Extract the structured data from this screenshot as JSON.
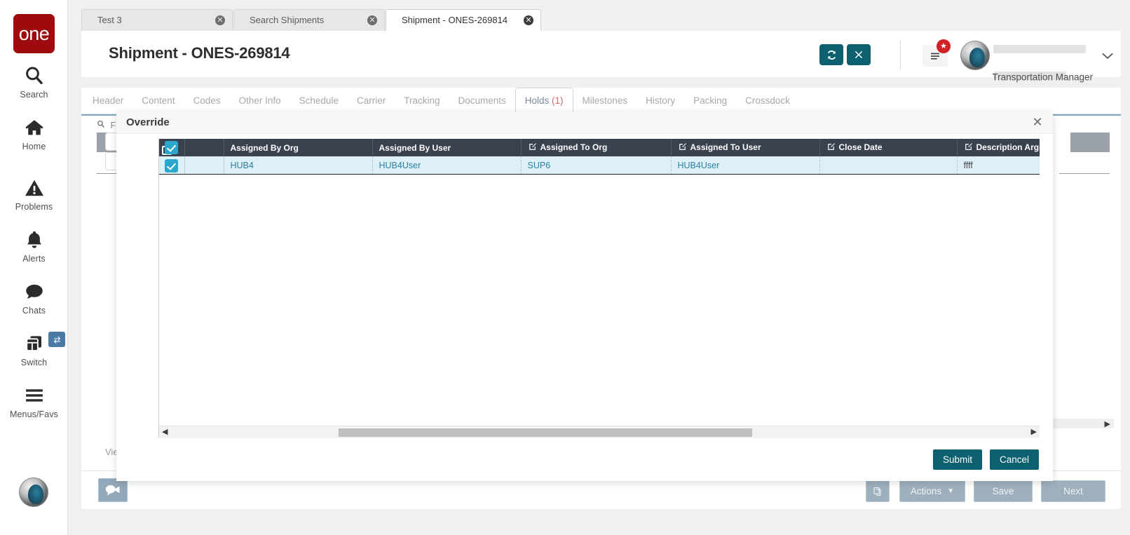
{
  "brand": {
    "logo_text": "one"
  },
  "rail": {
    "items": [
      {
        "label": "Search",
        "icon": "search-icon"
      },
      {
        "label": "Home",
        "icon": "home-icon"
      },
      {
        "label": "Problems",
        "icon": "warning-triangle-icon"
      },
      {
        "label": "Alerts",
        "icon": "bell-icon"
      },
      {
        "label": "Chats",
        "icon": "chat-bubble-icon"
      },
      {
        "label": "Switch",
        "icon": "switch-windows-icon"
      },
      {
        "label": "Menus/Favs",
        "icon": "hamburger-icon"
      }
    ],
    "switch_badge_icon": "swap-arrows-icon",
    "avatar_icon": "user-avatar"
  },
  "browser_tabs": [
    {
      "label": "Test 3",
      "active": false,
      "close_icon": "close-circle-icon"
    },
    {
      "label": "Search Shipments",
      "active": false,
      "close_icon": "close-circle-icon"
    },
    {
      "label": "Shipment - ONES-269814",
      "active": true,
      "close_icon": "close-circle-icon"
    }
  ],
  "header": {
    "title": "Shipment - ONES-269814",
    "refresh_icon": "refresh-icon",
    "close_icon": "x-icon",
    "menu_icon": "list-menu-icon",
    "menu_badge_icon": "star-icon",
    "avatar_icon": "user-avatar",
    "user_role": "Transportation Manager",
    "user_caret_icon": "chevron-down-icon"
  },
  "inner_tabs": [
    {
      "label": "Header",
      "active": false,
      "count": ""
    },
    {
      "label": "Content",
      "active": false,
      "count": ""
    },
    {
      "label": "Codes",
      "active": false,
      "count": ""
    },
    {
      "label": "Other Info",
      "active": false,
      "count": ""
    },
    {
      "label": "Schedule",
      "active": false,
      "count": ""
    },
    {
      "label": "Carrier",
      "active": false,
      "count": ""
    },
    {
      "label": "Tracking",
      "active": false,
      "count": ""
    },
    {
      "label": "Documents",
      "active": false,
      "count": ""
    },
    {
      "label": "Holds",
      "active": true,
      "count": "(1)"
    },
    {
      "label": "Milestones",
      "active": false,
      "count": ""
    },
    {
      "label": "History",
      "active": false,
      "count": ""
    },
    {
      "label": "Packing",
      "active": false,
      "count": ""
    },
    {
      "label": "Crossdock",
      "active": false,
      "count": ""
    }
  ],
  "background": {
    "filter_label": "Fil",
    "filter_icon": "search-icon",
    "view_label": "Vie",
    "chat_icon": "chat-bubbles-icon",
    "buttons": {
      "copy_icon": "copy-icon",
      "actions_label": "Actions",
      "actions_caret_icon": "caret-down-icon",
      "save_label": "Save",
      "next_label": "Next"
    }
  },
  "modal": {
    "title": "Override",
    "close_icon": "x-icon",
    "select_all_checked": true,
    "columns": [
      {
        "label": "",
        "editable": false,
        "type": "select"
      },
      {
        "label": "",
        "editable": false,
        "type": "gap"
      },
      {
        "label": "Assigned By Org",
        "editable": false,
        "type": "text"
      },
      {
        "label": "Assigned By User",
        "editable": false,
        "type": "text"
      },
      {
        "label": "Assigned To Org",
        "editable": true,
        "type": "text"
      },
      {
        "label": "Assigned To User",
        "editable": true,
        "type": "text"
      },
      {
        "label": "Close Date",
        "editable": true,
        "type": "text"
      },
      {
        "label": "Description Args",
        "editable": true,
        "type": "text"
      }
    ],
    "rows": [
      {
        "selected": true,
        "assigned_by_org": "HUB4",
        "assigned_by_user": "HUB4User",
        "assigned_to_org": "SUP6",
        "assigned_to_user": "HUB4User",
        "close_date": "",
        "description_args": "ffff"
      }
    ],
    "hscroll": {
      "left_arrow_icon": "caret-left-icon",
      "right_arrow_icon": "caret-right-icon"
    },
    "submit_label": "Submit",
    "cancel_label": "Cancel"
  },
  "colors": {
    "brand_red": "#9e0b0f",
    "teal_button": "#0d6070",
    "grid_header": "#3a414f",
    "row_selected": "#ddf0f8",
    "checkbox_blue": "#2ba7ce",
    "link_text": "#2d7f9e",
    "tab_accent": "#7fa7bb",
    "badge_red": "#d32027"
  }
}
